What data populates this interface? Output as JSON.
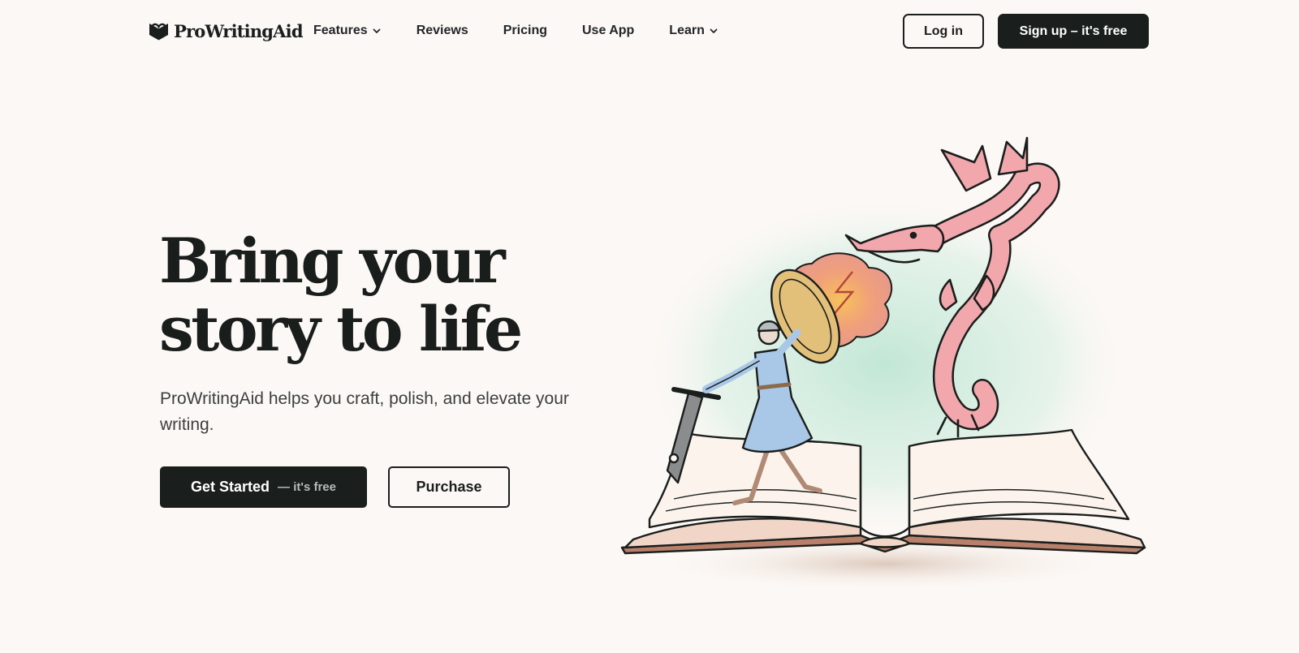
{
  "header": {
    "logo_text": "ProWritingAid",
    "nav": [
      {
        "label": "Features",
        "has_dropdown": true
      },
      {
        "label": "Reviews",
        "has_dropdown": false
      },
      {
        "label": "Pricing",
        "has_dropdown": false
      },
      {
        "label": "Use App",
        "has_dropdown": false
      },
      {
        "label": "Learn",
        "has_dropdown": true
      }
    ],
    "login_label": "Log in",
    "signup_label": "Sign up – it's free"
  },
  "hero": {
    "title_line1": "Bring your",
    "title_line2": "story to life",
    "subtitle": "ProWritingAid helps you craft, polish, and elevate your writing.",
    "cta_primary_label": "Get Started",
    "cta_primary_sublabel": "— it's free",
    "cta_secondary_label": "Purchase"
  },
  "colors": {
    "background": "#fcf8f5",
    "primary_dark": "#1a1f1d",
    "dragon": "#f2a7ad",
    "knight_tunic": "#a9c8e8",
    "mist": "#bfe6d4"
  },
  "icons": {
    "logo": "book-heart-icon",
    "dropdown": "chevron-down-icon"
  }
}
